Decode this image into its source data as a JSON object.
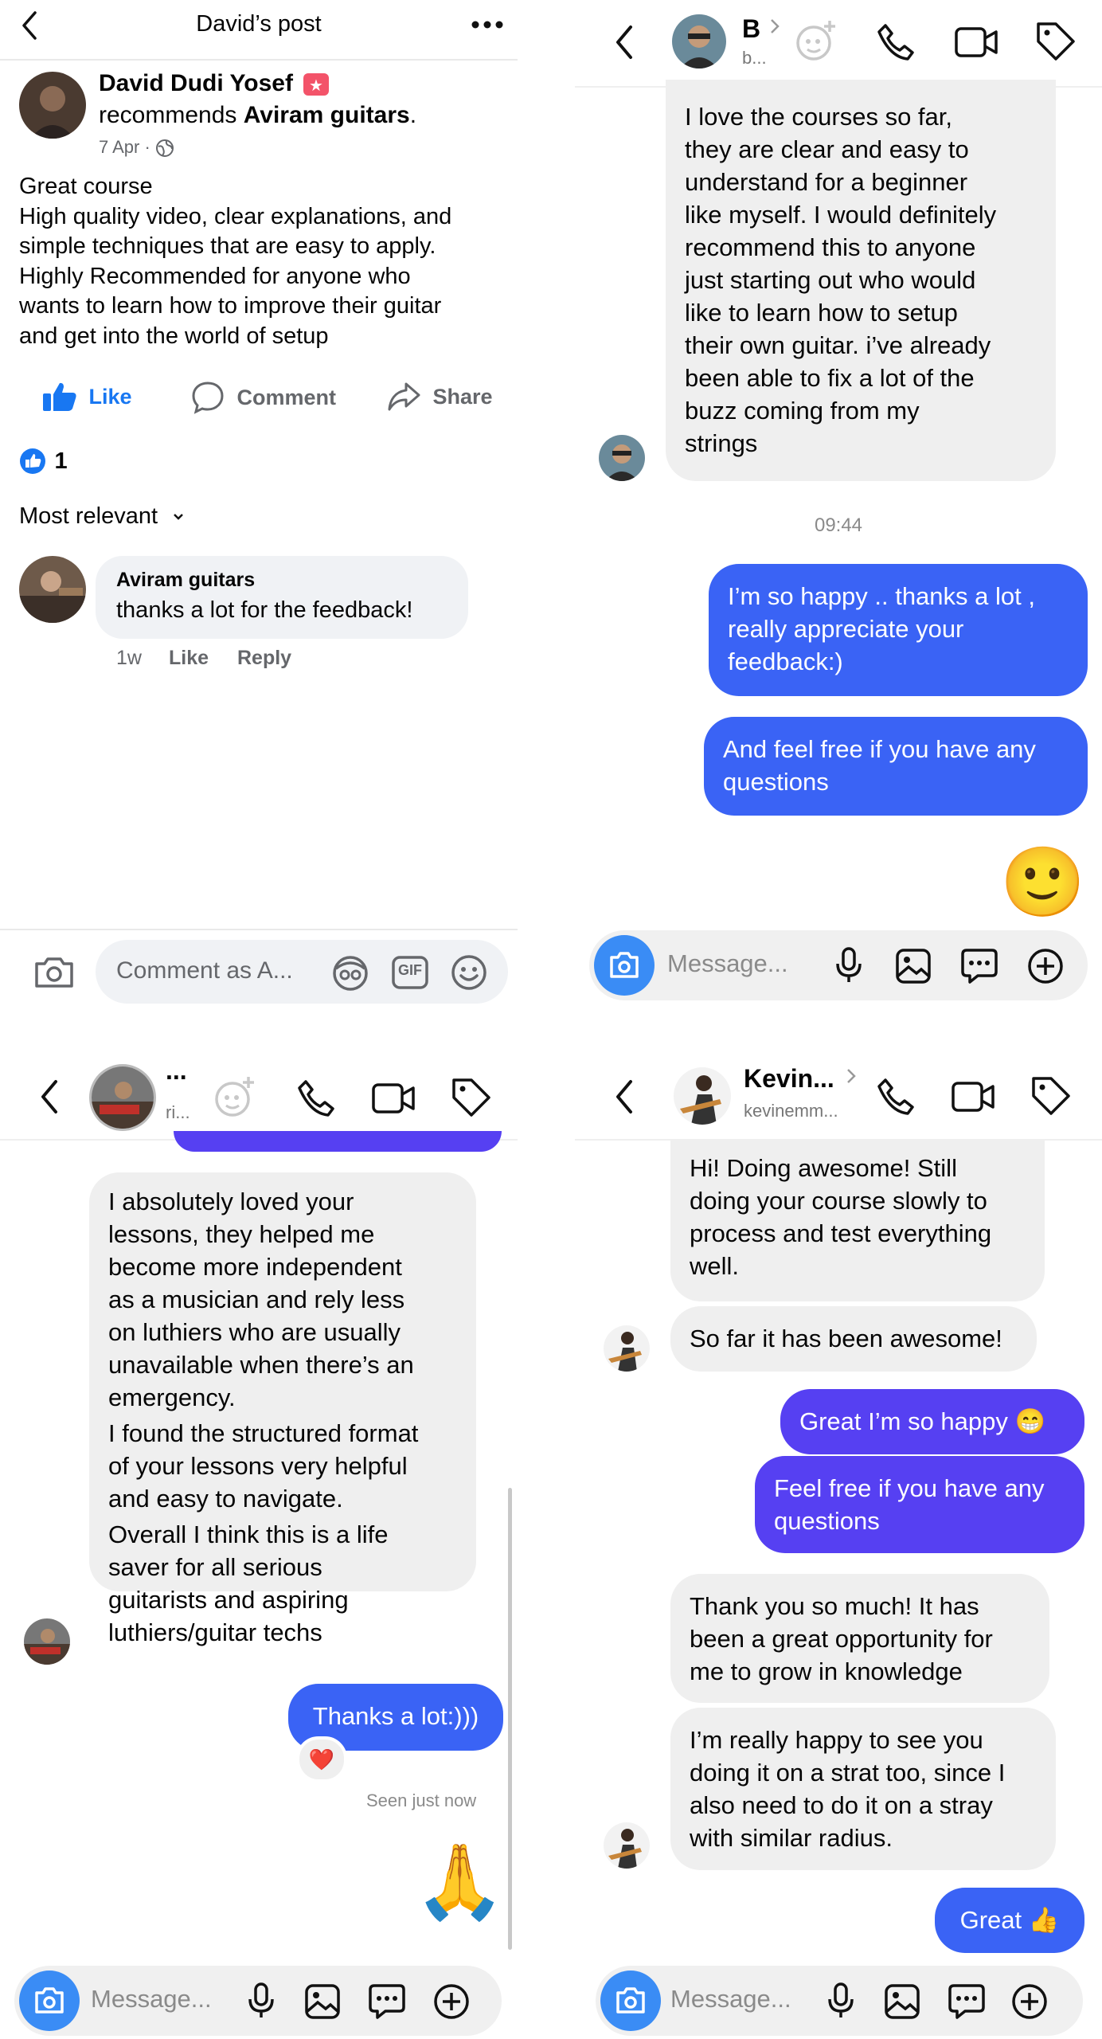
{
  "post": {
    "header_title": "David’s post",
    "author": "David Dudi Yosef",
    "recommends_prefix": "recommends ",
    "recommends_page": "Aviram guitars",
    "recommends_suffix": ".",
    "date": "7 Apr ·",
    "body": [
      "Great course",
      "High quality video, clear explanations, and",
      "simple techniques that are easy to apply.",
      "Highly Recommended for anyone who",
      "wants to learn how to improve their guitar",
      "and get into the world of setup"
    ],
    "actions": {
      "like": "Like",
      "comment": "Comment",
      "share": "Share"
    },
    "reaction_count": "1",
    "sort_label": "Most relevant",
    "comment": {
      "author": "Aviram guitars",
      "text": "thanks a lot for the feedback!",
      "age": "1w",
      "like": "Like",
      "reply": "Reply"
    },
    "input_placeholder": "Comment as A...",
    "gif_label": "GIF"
  },
  "chat1": {
    "contact_name": "B",
    "contact_sub": "b...",
    "incoming": [
      "I love the courses so far,",
      "they are clear and easy to",
      "understand for a beginner",
      "like myself. I would definitely",
      "recommend this to anyone",
      "just starting out who would",
      "like to learn how to setup",
      "their own guitar. i’ve already",
      "been able to fix a lot of the",
      "buzz coming from my",
      "strings"
    ],
    "timestamp": "09:44",
    "outgoing_1": [
      "I’m so happy .. thanks a lot ,",
      "really appreciate your",
      "feedback:)"
    ],
    "outgoing_2": [
      "And feel free if you have any",
      "questions"
    ],
    "emoji": "🙂",
    "input_placeholder": "Message..."
  },
  "chat2": {
    "contact_name": "...",
    "contact_sub": "ri...",
    "incoming": [
      "I absolutely loved your",
      "lessons, they helped me",
      "become more independent",
      "as a musician and rely less",
      "on luthiers who are usually",
      "unavailable when there’s an",
      "emergency.",
      "I found the structured format",
      "of your lessons very helpful",
      "and easy to navigate.",
      "Overall I think this is a life",
      "saver for all serious",
      "guitarists and aspiring",
      "luthiers/guitar techs"
    ],
    "outgoing": "Thanks a lot:)))",
    "reaction": "❤️",
    "seen": "Seen just now",
    "emoji": "🙏",
    "input_placeholder": "Message..."
  },
  "chat3": {
    "contact_name": "Kevin...",
    "contact_sub": "kevinemm...",
    "in_1": [
      "Hi! Doing awesome! Still",
      "doing your course slowly to",
      "process and test everything",
      "well."
    ],
    "in_2": "So far it has been awesome!",
    "out_1": "Great I’m so happy 😁",
    "out_2": [
      "Feel free if you have any",
      "questions"
    ],
    "in_3": [
      "Thank you so much! It has",
      "been a great opportunity for",
      "me to grow in knowledge"
    ],
    "in_4": [
      "I’m really happy to see you",
      "doing it on a strat too, since I",
      "also need to do it on a stray",
      "with similar radius."
    ],
    "out_3": "Great 👍",
    "input_placeholder": "Message..."
  },
  "colors": {
    "fb_blue": "#1877f2",
    "messenger_blue": "#3a63f5",
    "messenger_purple": "#5640f2",
    "bubble_gray": "#efefef"
  }
}
